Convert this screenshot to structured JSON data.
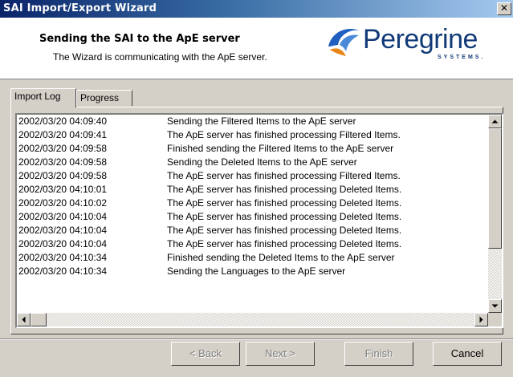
{
  "window": {
    "title": "SAI Import/Export Wizard",
    "close": "✕"
  },
  "header": {
    "title": "Sending the SAI to the ApE server",
    "subtitle": "The Wizard is communicating with the ApE server.",
    "logo_text": "Peregrine",
    "logo_sub": "SYSTEMS."
  },
  "tabs": [
    {
      "label": "Import Log",
      "active": true
    },
    {
      "label": "Progress",
      "active": false
    }
  ],
  "log": [
    {
      "ts": "2002/03/20 04:09:40",
      "msg": "Sending the Filtered Items to the ApE server"
    },
    {
      "ts": "2002/03/20 04:09:41",
      "msg": "The ApE server has finished processing Filtered Items."
    },
    {
      "ts": "2002/03/20 04:09:58",
      "msg": "Finished sending the Filtered Items to the ApE server"
    },
    {
      "ts": "2002/03/20 04:09:58",
      "msg": "Sending the Deleted Items to the ApE server"
    },
    {
      "ts": "2002/03/20 04:09:58",
      "msg": "The ApE server has finished processing Filtered Items."
    },
    {
      "ts": "2002/03/20 04:10:01",
      "msg": "The ApE server has finished processing Deleted Items."
    },
    {
      "ts": "2002/03/20 04:10:02",
      "msg": "The ApE server has finished processing Deleted Items."
    },
    {
      "ts": "2002/03/20 04:10:04",
      "msg": "The ApE server has finished processing Deleted Items."
    },
    {
      "ts": "2002/03/20 04:10:04",
      "msg": "The ApE server has finished processing Deleted Items."
    },
    {
      "ts": "2002/03/20 04:10:04",
      "msg": "The ApE server has finished processing Deleted Items."
    },
    {
      "ts": "2002/03/20 04:10:34",
      "msg": "Finished sending the Deleted Items to the ApE server"
    },
    {
      "ts": "2002/03/20 04:10:34",
      "msg": "Sending the Languages to the ApE server"
    }
  ],
  "buttons": {
    "back": "< Back",
    "next": "Next >",
    "finish": "Finish",
    "cancel": "Cancel"
  },
  "colors": {
    "titlebar_start": "#0a246a",
    "titlebar_end": "#a6caf0",
    "logo": "#123a78",
    "face": "#d4d0c8"
  }
}
